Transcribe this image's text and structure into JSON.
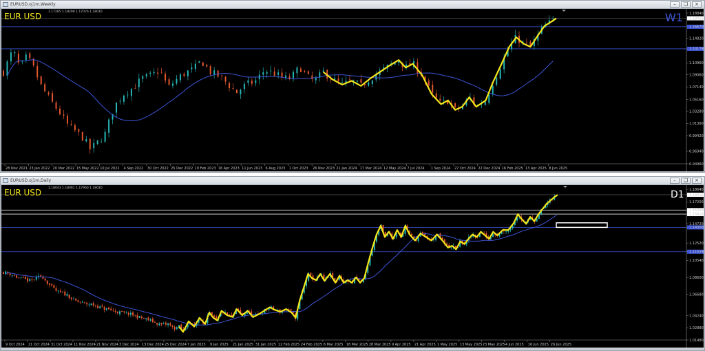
{
  "windows": [
    {
      "title": "EURUSD.oj1m,Weekly",
      "ohlc": "1.17285 1.18299 1.17076 1.18016",
      "symbol": "EUR USD",
      "timeframe": "W1",
      "price_labels": [
        "1.18840",
        "1.18016",
        "1.16670",
        "1.14820",
        "1.13179",
        "1.10960",
        "1.09060",
        "1.07140",
        "1.05160",
        "1.03280",
        "1.01360",
        "0.99420",
        "0.96940",
        "0.94960"
      ],
      "time_labels": [
        "28 Nov 2021",
        "23 Jan 2022",
        "20 Mar 2022",
        "15 May 2022",
        "10 Jul 2022",
        "4 Sep 2022",
        "30 Oct 2022",
        "25 Dec 2022",
        "19 Feb 2023",
        "16 Apr 2023",
        "11 Jun 2023",
        "6 Aug 2023",
        "1 Oct 2023",
        "26 Nov 2023",
        "21 Jan 2024",
        "17 Mar 2024",
        "12 May 2024",
        "7 Jul 2024",
        "1 Sep 2024",
        "27 Oct 2024",
        "22 Dec 2024",
        "16 Feb 2025",
        "13 Apr 2025",
        "8 Jun 2025"
      ]
    },
    {
      "title": "EURUSD.oj1m,Daily",
      "ohlc": "1.18043 1.18061 1.17960 1.18016",
      "symbol": "EUR USD",
      "timeframe": "D1",
      "price_labels": [
        "1.18640",
        "1.18016",
        "1.17200",
        "1.16268",
        "1.15816",
        "1.14720",
        "1.14300",
        "1.12520",
        "1.11529",
        "1.10540",
        "1.08600",
        "1.06680",
        "1.04240",
        "1.02880",
        "1.01480"
      ],
      "time_labels": [
        "9 Oct 2024",
        "21 Oct 2024",
        "31 Oct 2024",
        "11 Nov 2024",
        "21 Nov 2024",
        "3 Dec 2024",
        "13 Dec 2024",
        "25 Dec 2024",
        "7 Jan 2025",
        "9 Jan 2025",
        "21 Jan 2025",
        "31 Jan 2025",
        "12 Feb 2025",
        "24 Feb 2025",
        "6 Mar 2025",
        "18 Mar 2025",
        "28 Mar 2025",
        "9 Apr 2025",
        "21 Apr 2025",
        "1 May 2025",
        "13 May 2025",
        "23 May 2025",
        "4 Jun 2025",
        "16 Jun 2025",
        "26 Jun 2025"
      ]
    }
  ],
  "chart_data": [
    {
      "type": "candlestick",
      "symbol": "EUR USD",
      "timeframe": "W1",
      "ylim": [
        0.9496,
        1.1884
      ],
      "current_price": 1.18016,
      "levels": [
        1.1667,
        1.13179
      ],
      "colors": {
        "bull": "#26b5b5",
        "bear": "#e4572e",
        "ma": "#3d55d6",
        "zigzag": "#f5e61a",
        "level": "#3d55d6"
      },
      "close_path": [
        [
          0,
          1.095
        ],
        [
          8,
          1.13
        ],
        [
          14,
          1.102
        ],
        [
          20,
          1.12
        ],
        [
          26,
          1.1
        ],
        [
          32,
          1.073
        ],
        [
          40,
          1.05
        ],
        [
          48,
          1.03
        ],
        [
          55,
          1.01
        ],
        [
          62,
          1.0
        ],
        [
          68,
          0.99
        ],
        [
          74,
          0.972
        ],
        [
          78,
          0.98
        ],
        [
          86,
          0.995
        ],
        [
          94,
          1.04
        ],
        [
          102,
          1.06
        ],
        [
          110,
          1.07
        ],
        [
          118,
          1.085
        ],
        [
          126,
          1.09
        ],
        [
          133,
          1.098
        ],
        [
          140,
          1.07
        ],
        [
          148,
          1.085
        ],
        [
          155,
          1.094
        ],
        [
          162,
          1.1
        ],
        [
          168,
          1.113
        ],
        [
          176,
          1.095
        ],
        [
          186,
          1.085
        ],
        [
          198,
          1.062
        ],
        [
          206,
          1.075
        ],
        [
          214,
          1.08
        ],
        [
          222,
          1.098
        ],
        [
          230,
          1.093
        ],
        [
          238,
          1.085
        ],
        [
          244,
          1.085
        ],
        [
          252,
          1.103
        ],
        [
          258,
          1.088
        ],
        [
          264,
          1.08
        ],
        [
          272,
          1.095
        ],
        [
          280,
          1.083
        ],
        [
          288,
          1.075
        ],
        [
          296,
          1.081
        ],
        [
          304,
          1.073
        ],
        [
          312,
          1.085
        ],
        [
          320,
          1.095
        ],
        [
          328,
          1.105
        ],
        [
          336,
          1.114
        ],
        [
          342,
          1.102
        ],
        [
          348,
          1.108
        ],
        [
          356,
          1.09
        ],
        [
          364,
          1.06
        ],
        [
          372,
          1.044
        ],
        [
          378,
          1.05
        ],
        [
          384,
          1.035
        ],
        [
          390,
          1.04
        ],
        [
          396,
          1.055
        ],
        [
          402,
          1.04
        ],
        [
          410,
          1.05
        ],
        [
          416,
          1.078
        ],
        [
          424,
          1.11
        ],
        [
          430,
          1.135
        ],
        [
          436,
          1.15
        ],
        [
          442,
          1.14
        ],
        [
          448,
          1.135
        ],
        [
          454,
          1.152
        ],
        [
          460,
          1.168
        ],
        [
          466,
          1.175
        ],
        [
          470,
          1.18
        ]
      ]
    },
    {
      "type": "candlestick",
      "symbol": "EUR USD",
      "timeframe": "D1",
      "ylim": [
        1.0148,
        1.1864
      ],
      "current_price": 1.18016,
      "levels": [
        1.16268,
        1.15816,
        1.143,
        1.11529
      ],
      "colors": {
        "bull": "#26b5b5",
        "bear": "#e4572e",
        "ma": "#3d55d6",
        "zigzag": "#f5e61a",
        "level": "#3d55d6"
      },
      "close_path": [
        [
          0,
          1.092
        ],
        [
          10,
          1.09
        ],
        [
          20,
          1.086
        ],
        [
          30,
          1.084
        ],
        [
          40,
          1.082
        ],
        [
          50,
          1.086
        ],
        [
          56,
          1.088
        ],
        [
          62,
          1.082
        ],
        [
          70,
          1.075
        ],
        [
          78,
          1.07
        ],
        [
          86,
          1.068
        ],
        [
          94,
          1.066
        ],
        [
          102,
          1.06
        ],
        [
          110,
          1.058
        ],
        [
          120,
          1.056
        ],
        [
          130,
          1.055
        ],
        [
          140,
          1.052
        ],
        [
          150,
          1.05
        ],
        [
          160,
          1.048
        ],
        [
          170,
          1.046
        ],
        [
          180,
          1.045
        ],
        [
          190,
          1.043
        ],
        [
          200,
          1.04
        ],
        [
          210,
          1.038
        ],
        [
          220,
          1.035
        ],
        [
          230,
          1.032
        ],
        [
          240,
          1.033
        ],
        [
          248,
          1.028
        ],
        [
          256,
          1.03
        ],
        [
          262,
          1.024
        ],
        [
          270,
          1.036
        ],
        [
          278,
          1.03
        ],
        [
          286,
          1.04
        ],
        [
          294,
          1.033
        ],
        [
          300,
          1.046
        ],
        [
          306,
          1.04
        ],
        [
          312,
          1.037
        ],
        [
          318,
          1.048
        ],
        [
          326,
          1.043
        ],
        [
          334,
          1.041
        ],
        [
          340,
          1.05
        ],
        [
          348,
          1.043
        ],
        [
          356,
          1.048
        ],
        [
          364,
          1.041
        ],
        [
          372,
          1.044
        ],
        [
          380,
          1.048
        ],
        [
          388,
          1.052
        ],
        [
          396,
          1.049
        ],
        [
          404,
          1.047
        ],
        [
          412,
          1.05
        ],
        [
          420,
          1.046
        ],
        [
          426,
          1.04
        ],
        [
          432,
          1.06
        ],
        [
          438,
          1.075
        ],
        [
          444,
          1.09
        ],
        [
          450,
          1.085
        ],
        [
          456,
          1.083
        ],
        [
          462,
          1.09
        ],
        [
          468,
          1.082
        ],
        [
          476,
          1.09
        ],
        [
          484,
          1.08
        ],
        [
          490,
          1.088
        ],
        [
          496,
          1.08
        ],
        [
          502,
          1.083
        ],
        [
          508,
          1.08
        ],
        [
          514,
          1.086
        ],
        [
          520,
          1.08
        ],
        [
          526,
          1.085
        ],
        [
          532,
          1.103
        ],
        [
          538,
          1.12
        ],
        [
          544,
          1.135
        ],
        [
          550,
          1.145
        ],
        [
          556,
          1.132
        ],
        [
          562,
          1.138
        ],
        [
          568,
          1.13
        ],
        [
          574,
          1.14
        ],
        [
          580,
          1.132
        ],
        [
          586,
          1.145
        ],
        [
          592,
          1.135
        ],
        [
          600,
          1.128
        ],
        [
          608,
          1.136
        ],
        [
          616,
          1.132
        ],
        [
          624,
          1.128
        ],
        [
          632,
          1.135
        ],
        [
          640,
          1.128
        ],
        [
          648,
          1.12
        ],
        [
          654,
          1.122
        ],
        [
          660,
          1.118
        ],
        [
          666,
          1.127
        ],
        [
          672,
          1.124
        ],
        [
          678,
          1.13
        ],
        [
          684,
          1.135
        ],
        [
          690,
          1.132
        ],
        [
          696,
          1.138
        ],
        [
          702,
          1.134
        ],
        [
          708,
          1.13
        ],
        [
          714,
          1.138
        ],
        [
          720,
          1.134
        ],
        [
          728,
          1.14
        ],
        [
          736,
          1.14
        ],
        [
          744,
          1.148
        ],
        [
          750,
          1.158
        ],
        [
          756,
          1.152
        ],
        [
          762,
          1.147
        ],
        [
          768,
          1.155
        ],
        [
          774,
          1.15
        ],
        [
          780,
          1.158
        ],
        [
          786,
          1.164
        ],
        [
          792,
          1.17
        ],
        [
          798,
          1.174
        ],
        [
          804,
          1.178
        ],
        [
          808,
          1.18
        ]
      ]
    }
  ]
}
